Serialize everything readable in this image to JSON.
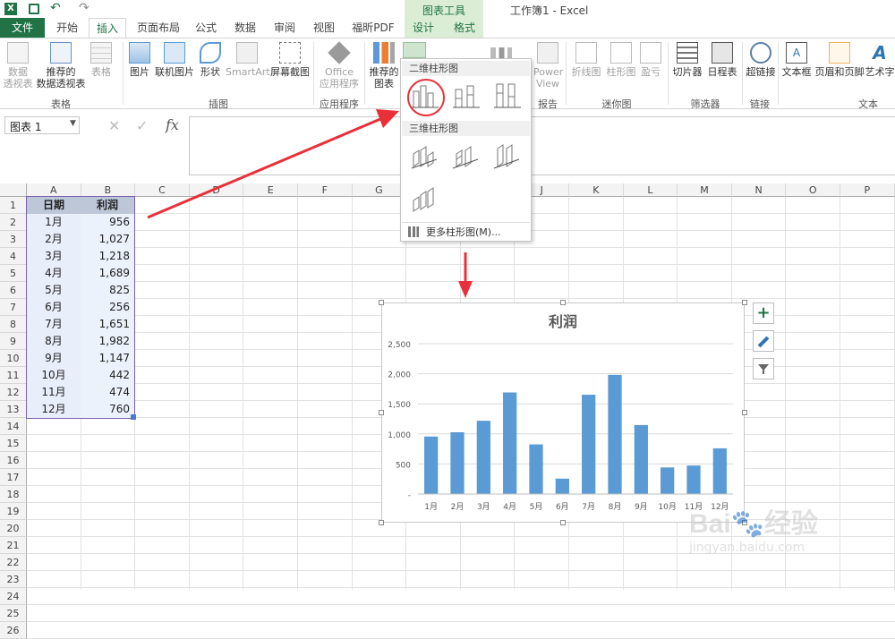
{
  "window": {
    "title": "工作簿1 - Excel",
    "context_tab_group": "图表工具"
  },
  "tabs": [
    "文件",
    "开始",
    "插入",
    "页面布局",
    "公式",
    "数据",
    "审阅",
    "视图",
    "福昕PDF",
    "设计",
    "格式"
  ],
  "active_tab": "插入",
  "ribbon": {
    "buttons": {
      "pivot": "数据\n透视表",
      "rec_pivot": "推荐的\n数据透视表",
      "table": "表格",
      "picture": "图片",
      "online_pic": "联机图片",
      "shapes": "形状",
      "smartart": "SmartArt",
      "screenshot": "屏幕截图",
      "office_apps": "Office\n应用程序",
      "rec_chart": "推荐的\n图表",
      "powerview": "Power\nView",
      "line_spark": "折线图",
      "col_spark": "柱形图",
      "winloss": "盈亏",
      "slicer": "切片器",
      "timeline": "日程表",
      "hyperlink": "超链接",
      "textbox": "文本框",
      "header_footer": "页眉和页脚",
      "wordart": "艺术字"
    },
    "groups": {
      "tables": "表格",
      "illustrations": "插图",
      "apps": "应用程序",
      "reports": "报告",
      "sparklines": "迷你图",
      "filters": "筛选器",
      "links": "链接",
      "text": "文本"
    }
  },
  "namebox": "图表 1",
  "formula_icons": {
    "cancel": "✕",
    "enter": "✓",
    "fx": "fx"
  },
  "columns": [
    "A",
    "B",
    "C",
    "D",
    "E",
    "F",
    "G",
    "H",
    "I",
    "J",
    "K",
    "L",
    "M",
    "N",
    "O",
    "P"
  ],
  "rows": [
    "1",
    "2",
    "3",
    "4",
    "5",
    "6",
    "7",
    "8",
    "9",
    "10",
    "11",
    "12",
    "13",
    "14",
    "15",
    "16",
    "17",
    "18",
    "19",
    "20",
    "21",
    "22",
    "23",
    "24",
    "25",
    "26"
  ],
  "table": {
    "headers": [
      "日期",
      "利润"
    ],
    "data": [
      [
        "1月",
        "956"
      ],
      [
        "2月",
        "1,027"
      ],
      [
        "3月",
        "1,218"
      ],
      [
        "4月",
        "1,689"
      ],
      [
        "5月",
        "825"
      ],
      [
        "6月",
        "256"
      ],
      [
        "7月",
        "1,651"
      ],
      [
        "8月",
        "1,982"
      ],
      [
        "9月",
        "1,147"
      ],
      [
        "10月",
        "442"
      ],
      [
        "11月",
        "474"
      ],
      [
        "12月",
        "760"
      ]
    ]
  },
  "dropdown": {
    "section_2d": "二维柱形图",
    "section_3d": "三维柱形图",
    "more": "更多柱形图(M)..."
  },
  "chart_data": {
    "type": "bar",
    "title": "利润",
    "categories": [
      "1月",
      "2月",
      "3月",
      "4月",
      "5月",
      "6月",
      "7月",
      "8月",
      "9月",
      "10月",
      "11月",
      "12月"
    ],
    "values": [
      956,
      1027,
      1218,
      1689,
      825,
      256,
      1651,
      1982,
      1147,
      442,
      474,
      760
    ],
    "yticks": [
      "-",
      "500",
      "1,000",
      "1,500",
      "2,000",
      "2,500"
    ],
    "ylim": [
      0,
      2500
    ],
    "grid": true,
    "bar_color": "#5b9bd5"
  },
  "colors": {
    "excel_green": "#217346",
    "arrow_red": "#e8303a"
  }
}
